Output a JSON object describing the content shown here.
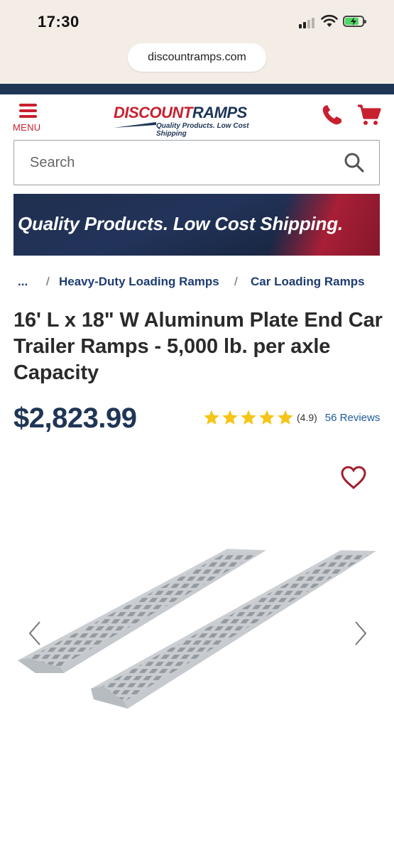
{
  "status_bar": {
    "time": "17:30"
  },
  "browser": {
    "url": "discountramps.com"
  },
  "header": {
    "menu_label": "MENU",
    "logo_text_red": "DISCOUNT",
    "logo_text_navy": "RAMPS",
    "logo_tagline": "Quality Products. Low Cost Shipping",
    "icons": [
      "phone-icon",
      "cart-icon"
    ]
  },
  "search": {
    "placeholder": "Search"
  },
  "banner": {
    "text": "Quality Products. Low Cost Shipping."
  },
  "breadcrumb": {
    "ellipsis": "...",
    "separator": "/",
    "items": [
      "Heavy-Duty Loading Ramps",
      "Car Loading Ramps"
    ]
  },
  "product": {
    "title": "16' L x 18\" W Aluminum Plate End Car Trailer Ramps - 5,000 lb. per axle Capacity",
    "price": "$2,823.99",
    "rating": 4.9,
    "rating_text": "(4.9)",
    "reviews": "56 Reviews"
  },
  "colors": {
    "brand_red": "#c8202f",
    "brand_navy": "#1e3556",
    "star": "#f5c518",
    "link": "#1e5a9c"
  }
}
